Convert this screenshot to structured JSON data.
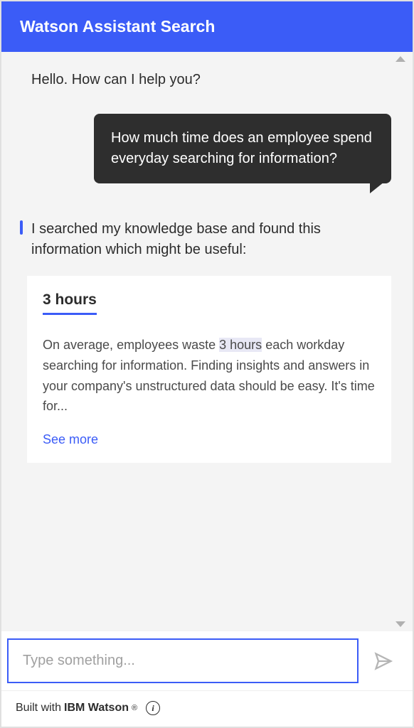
{
  "header": {
    "title": "Watson Assistant Search"
  },
  "chat": {
    "intro": "Hello. How can I help you?",
    "user_message": "How much time does an employee spend everyday searching for information?",
    "bot_response": "I searched my knowledge base and found this information which might be useful:",
    "card": {
      "title": "3 hours",
      "body_prefix": "On average, employees waste ",
      "body_highlight": "3 hours",
      "body_suffix": " each workday searching for information. Finding insights and answers in your company's unstructured data should be easy. It's time for...",
      "see_more": "See more"
    }
  },
  "input": {
    "placeholder": "Type something..."
  },
  "footer": {
    "prefix": "Built with ",
    "brand": "IBM Watson",
    "reg": "®"
  }
}
